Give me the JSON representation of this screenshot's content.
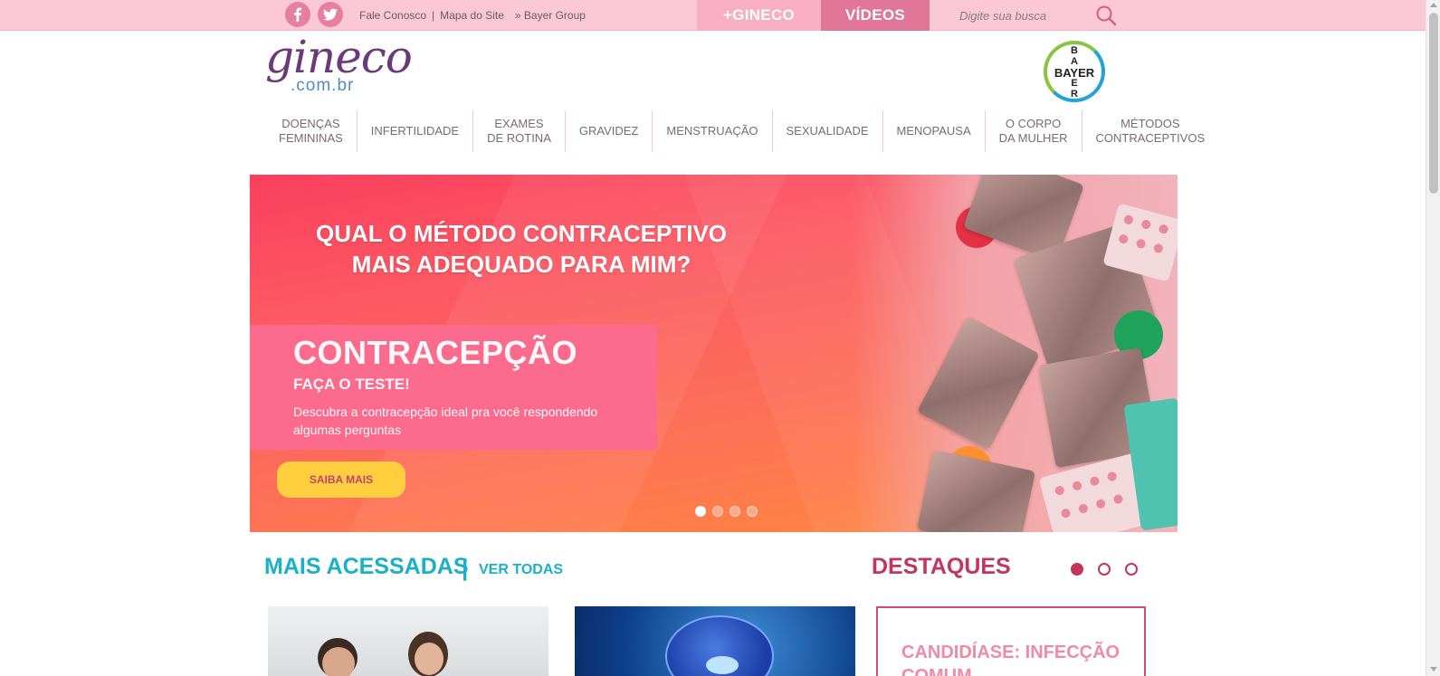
{
  "topbar": {
    "social": [
      {
        "name": "facebook-icon",
        "glyph": "f"
      },
      {
        "name": "twitter-icon",
        "glyph": "t"
      }
    ],
    "links": [
      "Fale Conosco",
      "|",
      "Mapa do Site",
      "» Bayer Group"
    ],
    "tab_gineco": "+GINECO",
    "tab_videos": "VÍDEOS",
    "search_placeholder": "Digite sua busca"
  },
  "logo": {
    "script": "gineco",
    "sub": ".com.br"
  },
  "bayer": {
    "horizontal": "BAYER",
    "vertical": [
      "B",
      "A",
      "",
      "E",
      "R"
    ]
  },
  "nav": [
    {
      "line1": "DOENÇAS",
      "line2": "FEMININAS"
    },
    {
      "line1": "INFERTILIDADE",
      "line2": ""
    },
    {
      "line1": "EXAMES",
      "line2": "DE ROTINA"
    },
    {
      "line1": "GRAVIDEZ",
      "line2": ""
    },
    {
      "line1": "MENSTRUAÇÃO",
      "line2": ""
    },
    {
      "line1": "SEXUALIDADE",
      "line2": ""
    },
    {
      "line1": "MENOPAUSA",
      "line2": ""
    },
    {
      "line1": "O CORPO",
      "line2": "DA MULHER"
    },
    {
      "line1": "MÉTODOS",
      "line2": "CONTRACEPTIVOS"
    }
  ],
  "hero": {
    "headline_line1": "QUAL O MÉTODO CONTRACEPTIVO",
    "headline_line2": "MAIS ADEQUADO PARA MIM?",
    "title": "CONTRACEPÇÃO",
    "subtitle": "FAÇA O TESTE!",
    "description": "Descubra a contracepção ideal pra você respondendo algumas perguntas",
    "button": "SAIBA MAIS",
    "slide_count": 4,
    "active_slide": 1
  },
  "sections": {
    "mais_acessadas": "MAIS ACESSADAS",
    "separator": "|",
    "ver_todas": "VER TODAS",
    "destaques": "DESTAQUES",
    "destaques_slide_count": 3,
    "destaques_active": 1
  },
  "cards": {
    "destaque_title": "CANDIDÍASE: INFECÇÃO COMUM"
  },
  "colors": {
    "topbar": "#fbc9d6",
    "accent_pink": "#e07698",
    "teal": "#1ab0c8",
    "magenta": "#c0365f",
    "cta_yellow": "#ffcf3f"
  }
}
